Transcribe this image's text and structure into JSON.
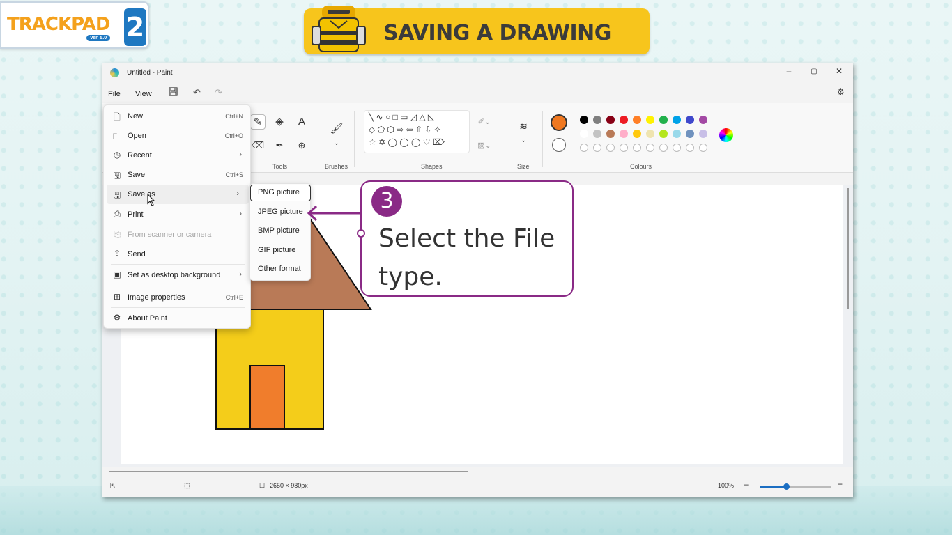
{
  "logo": {
    "text": "TRACKPAD",
    "version": "Ver. 5.0",
    "number": "2"
  },
  "banner": {
    "title": "SAVING A DRAWING"
  },
  "window": {
    "title": "Untitled - Paint",
    "controls": {
      "minimize": "–",
      "maximize": "▢",
      "close": "✕"
    }
  },
  "menubar": {
    "file": "File",
    "view": "View"
  },
  "ribbon": {
    "groups": {
      "tools": "Tools",
      "brushes": "Brushes",
      "shapes": "Shapes",
      "size": "Size",
      "colours": "Colours"
    },
    "selected_color": "#f07820",
    "palette_row1": [
      "#000000",
      "#7f7f7f",
      "#880015",
      "#ed1c24",
      "#ff7f27",
      "#fff200",
      "#22b14c",
      "#00a2e8",
      "#3f48cc",
      "#a349a4"
    ],
    "palette_row2": [
      "#ffffff",
      "#c3c3c3",
      "#b97a57",
      "#ffaec9",
      "#ffc90e",
      "#efe4b0",
      "#b5e61d",
      "#99d9ea",
      "#7092be",
      "#c8bfe7"
    ]
  },
  "file_menu": {
    "items": [
      {
        "label": "New",
        "shortcut": "Ctrl+N",
        "icon": "new-file-icon"
      },
      {
        "label": "Open",
        "shortcut": "Ctrl+O",
        "icon": "folder-icon"
      },
      {
        "label": "Recent",
        "shortcut": "",
        "icon": "clock-icon"
      },
      {
        "label": "Save",
        "shortcut": "Ctrl+S",
        "icon": "save-icon"
      },
      {
        "label": "Save as",
        "shortcut": "",
        "icon": "save-as-icon"
      },
      {
        "label": "Print",
        "shortcut": "",
        "icon": "printer-icon"
      },
      {
        "label": "From scanner or camera",
        "shortcut": "",
        "icon": "scanner-icon"
      },
      {
        "label": "Send",
        "shortcut": "",
        "icon": "share-icon"
      },
      {
        "label": "Set as desktop background",
        "shortcut": "",
        "icon": "desktop-icon"
      },
      {
        "label": "Image properties",
        "shortcut": "Ctrl+E",
        "icon": "image-properties-icon"
      },
      {
        "label": "About Paint",
        "shortcut": "",
        "icon": "settings-icon"
      }
    ]
  },
  "save_as_submenu": {
    "items": [
      "PNG picture",
      "JPEG picture",
      "BMP picture",
      "GIF picture",
      "Other format"
    ]
  },
  "callout": {
    "step": "3",
    "text": "Select the File type."
  },
  "status": {
    "dimensions": "2650 × 980px",
    "zoom": "100%",
    "zoom_minus": "–",
    "zoom_plus": "+"
  }
}
